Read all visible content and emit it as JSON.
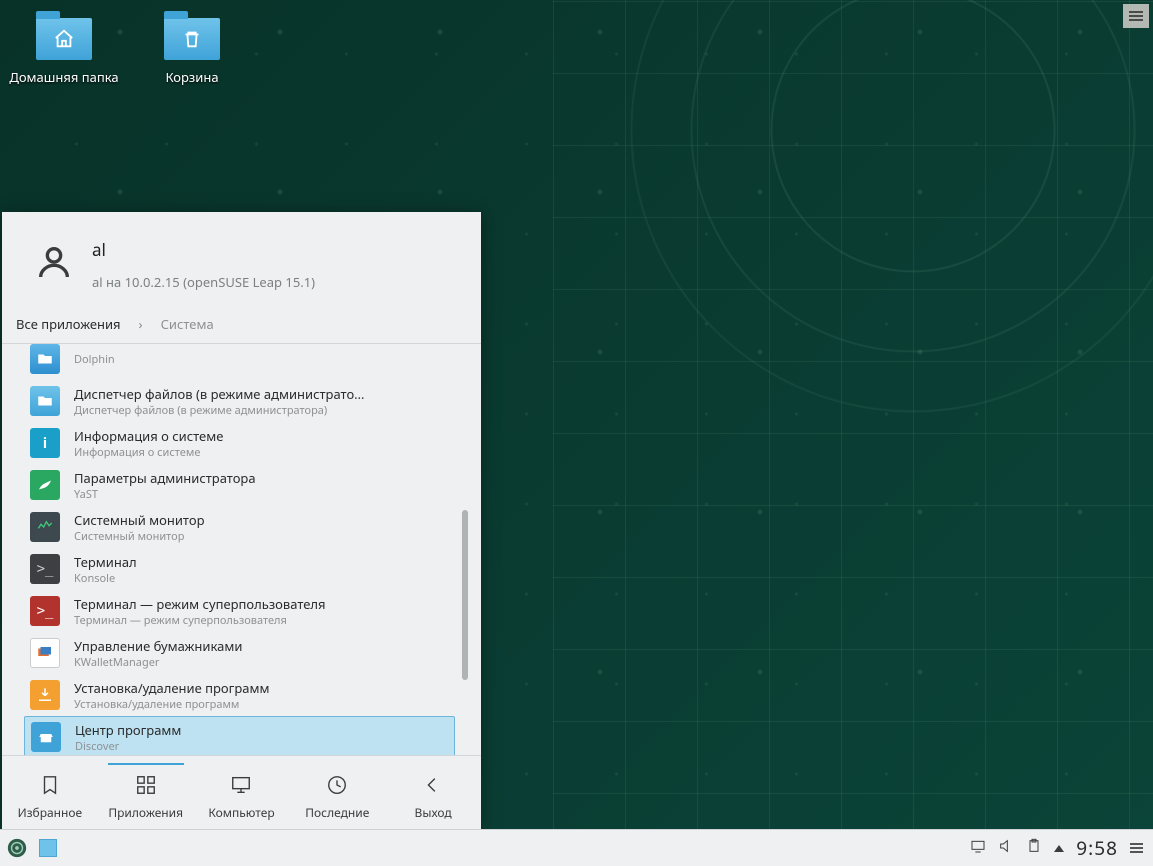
{
  "desktop": {
    "home_label": "Домашняя папка",
    "trash_label": "Корзина"
  },
  "launcher": {
    "user_name": "al",
    "user_host": "al на 10.0.2.15 (openSUSE Leap 15.1)",
    "breadcrumb_root": "Все приложения",
    "breadcrumb_current": "Система",
    "apps": [
      {
        "title": "",
        "sub": "Dolphin",
        "icon": "dolphin"
      },
      {
        "title": "Диспетчер файлов (в режиме администрато…",
        "sub": "Диспетчер файлов (в режиме администратора)",
        "icon": "folder"
      },
      {
        "title": "Информация о системе",
        "sub": "Информация о системе",
        "icon": "info"
      },
      {
        "title": "Параметры администратора",
        "sub": "YaST",
        "icon": "yast"
      },
      {
        "title": "Системный монитор",
        "sub": "Системный монитор",
        "icon": "sysmon"
      },
      {
        "title": "Терминал",
        "sub": "Konsole",
        "icon": "term"
      },
      {
        "title": "Терминал — режим суперпользователя",
        "sub": "Терминал — режим суперпользователя",
        "icon": "rootterm"
      },
      {
        "title": "Управление бумажниками",
        "sub": "KWalletManager",
        "icon": "kwallet"
      },
      {
        "title": "Установка/удаление программ",
        "sub": "Установка/удаление программ",
        "icon": "install"
      },
      {
        "title": "Центр программ",
        "sub": "Discover",
        "icon": "discover"
      }
    ],
    "highlight_index": 9,
    "tabs": {
      "favorites": "Избранное",
      "applications": "Приложения",
      "computer": "Компьютер",
      "recent": "Последние",
      "leave": "Выход"
    },
    "active_tab": "applications"
  },
  "taskbar": {
    "clock": "9:58"
  }
}
